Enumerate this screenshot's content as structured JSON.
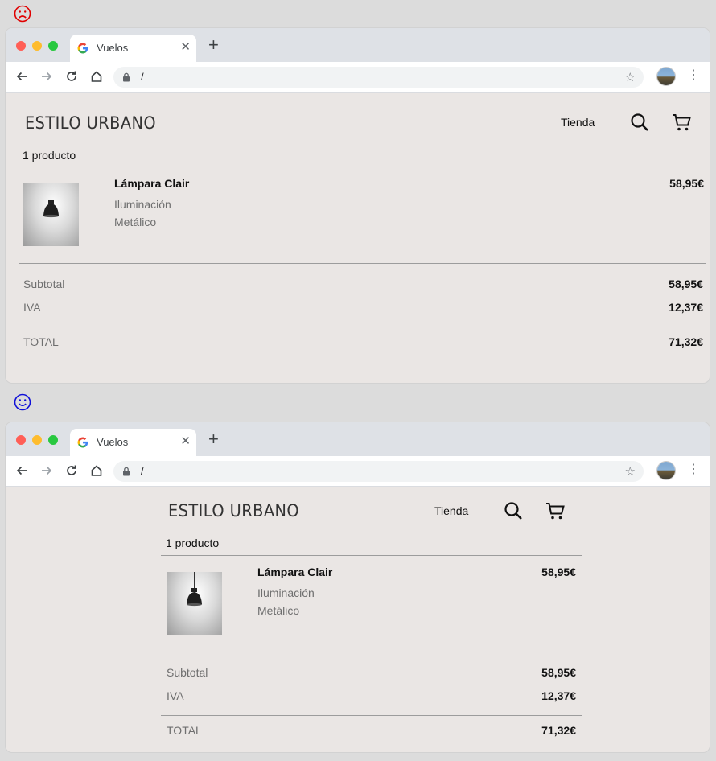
{
  "comparison": {
    "bad_face": "☹",
    "good_face": "☺"
  },
  "browser": {
    "tab_title": "Vuelos",
    "tab_close": "✕",
    "new_tab": "+",
    "url": "/",
    "menu": "⋮"
  },
  "store": {
    "brand": "ESTILO URBANO",
    "nav_link": "Tienda",
    "product_count": "1 producto",
    "product": {
      "name": "Lámpara Clair",
      "category": "Iluminación",
      "material": "Metálico",
      "price": "58,95€"
    },
    "summary": {
      "subtotal_label": "Subtotal",
      "subtotal_value": "58,95€",
      "tax_label": "IVA",
      "tax_value": "12,37€",
      "total_label": "TOTAL",
      "total_value": "71,32€"
    }
  },
  "colors": {
    "sad_face": "#e00000",
    "happy_face": "#1010d8",
    "page_bg": "#eae6e4"
  }
}
